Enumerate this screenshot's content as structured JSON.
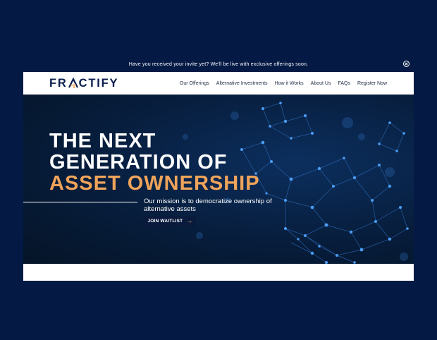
{
  "announcement": {
    "text": "Have you received your invite yet? We'll be live with exclusive offerings soon."
  },
  "logo": {
    "text_before": "FR",
    "text_after": "CTIFY",
    "accent_color": "#efa45a",
    "brand_color": "#0b1e4f"
  },
  "nav": {
    "items": [
      "Our Offerings",
      "Alternative Investments",
      "How it Works",
      "About Us",
      "FAQs",
      "Register Now"
    ]
  },
  "hero": {
    "line1": "THE NEXT",
    "line2": "GENERATION OF",
    "line3": "ASSET OWNERSHIP",
    "mission": "Our mission is to democratize ownership of alternative assets",
    "cta": "JOIN WAITLIST"
  },
  "colors": {
    "background": "#041a45",
    "accent": "#efa45a",
    "node": "#3b8df0"
  },
  "icons": {
    "close": "close-circle-icon",
    "cta_arrow": "arrow-right-icon",
    "logo_mark": "triangle-a-icon"
  }
}
